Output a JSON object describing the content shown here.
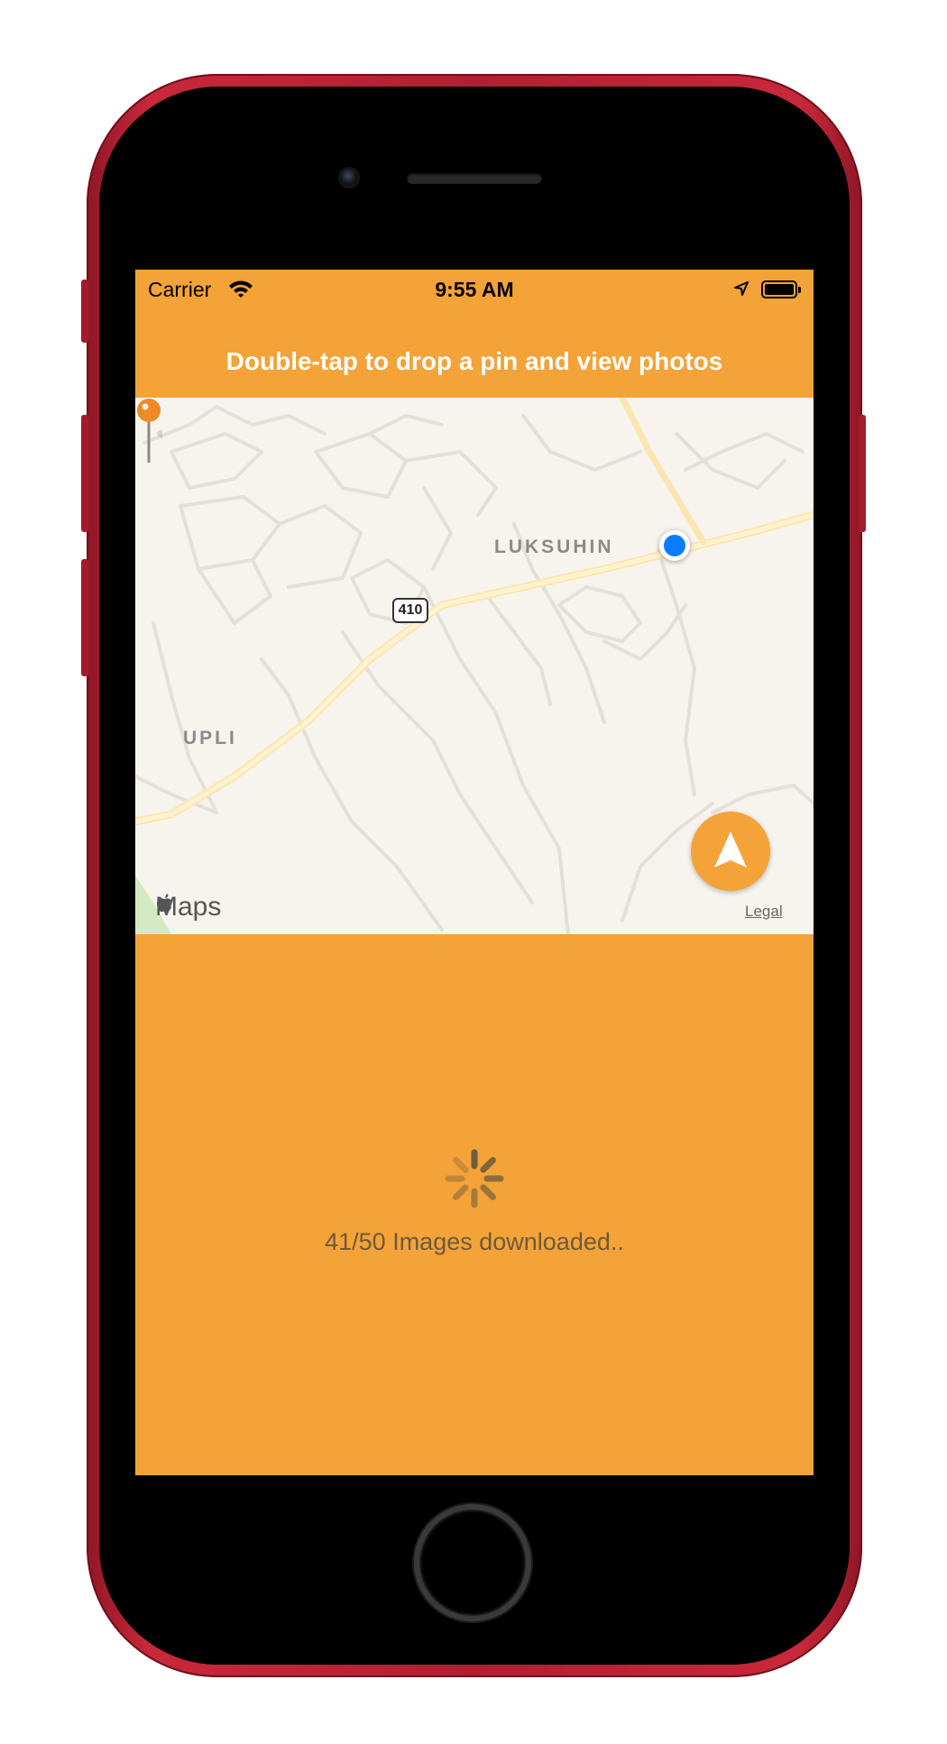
{
  "status_bar": {
    "carrier": "Carrier",
    "time": "9:55 AM",
    "icons": [
      "wifi-icon",
      "location-arrow-icon",
      "battery-icon"
    ]
  },
  "header": {
    "title": "Double-tap to drop a pin and view photos"
  },
  "map": {
    "labels": {
      "neighborhood_1": "LUKSUHIN",
      "neighborhood_2": "UPLI"
    },
    "route_number": "410",
    "attribution": "Maps",
    "legal": "Legal",
    "pin_color": "#f08a24",
    "user_dot_color": "#0a7cff"
  },
  "loading": {
    "status_text": "41/50 Images downloaded.."
  },
  "colors": {
    "accent": "#f4a338",
    "phone_body": "#c8283a"
  }
}
